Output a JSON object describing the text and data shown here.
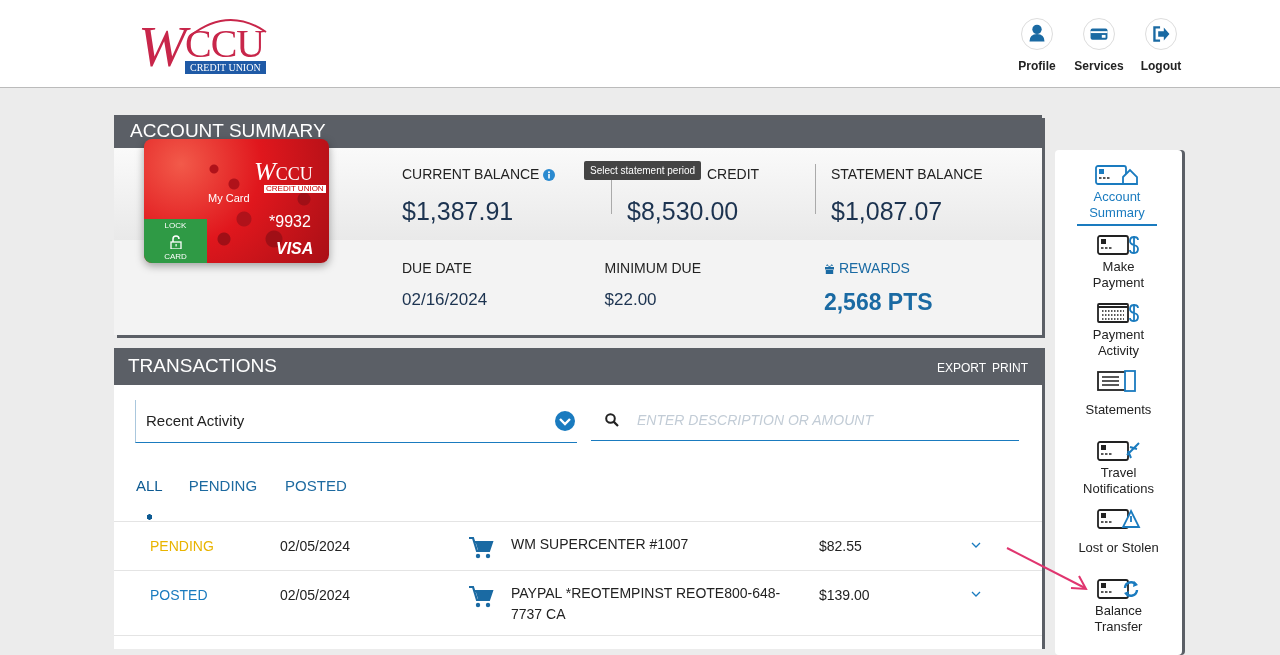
{
  "header": {
    "logo": {
      "letter": "W",
      "wordmark": "CCU",
      "tagline": "CREDIT UNION"
    },
    "actions": [
      {
        "label": "Profile",
        "kind": "profile"
      },
      {
        "label": "Services",
        "kind": "services"
      },
      {
        "label": "Logout",
        "kind": "logout"
      }
    ]
  },
  "account_summary": {
    "title": "ACCOUNT SUMMARY",
    "card": {
      "logo_letter": "W",
      "logo_wordmark": "CCU",
      "logo_tagline": "CREDIT UNION",
      "name": "My Card",
      "number": "*9932",
      "network": "VISA",
      "lock_top": "LOCK",
      "lock_bottom": "CARD"
    },
    "stats": [
      {
        "label": "CURRENT BALANCE",
        "value": "$1,387.91",
        "kind": "info"
      },
      {
        "label": "CREDIT",
        "value": "$8,530.00",
        "kind": "plain"
      },
      {
        "label": "STATEMENT BALANCE",
        "value": "$1,087.07",
        "kind": "plain"
      },
      {
        "label": "DUE DATE",
        "value": "02/16/2024",
        "kind": "plain"
      },
      {
        "label": "MINIMUM DUE",
        "value": "$22.00",
        "kind": "plain"
      },
      {
        "label": "REWARDS",
        "value": "2,568 PTS",
        "kind": "rewards"
      }
    ],
    "tooltip": "Select statement period"
  },
  "transactions": {
    "title": "TRANSACTIONS",
    "actions": [
      "EXPORT",
      "PRINT"
    ],
    "filter": {
      "value": "Recent Activity"
    },
    "search": {
      "placeholder": "ENTER DESCRIPTION OR AMOUNT"
    },
    "tabs": [
      {
        "label": "ALL",
        "selected": true
      },
      {
        "label": "PENDING",
        "selected": false
      },
      {
        "label": "POSTED",
        "selected": false
      }
    ],
    "rows": [
      {
        "status": "PENDING",
        "kind": "pending",
        "date": "02/05/2024",
        "description": "WM SUPERCENTER #1007",
        "amount": "$82.55"
      },
      {
        "status": "POSTED",
        "kind": "posted",
        "date": "02/05/2024",
        "description": "PAYPAL *REOTEMPINST REOTE800-648-7737 CA",
        "amount": "$139.00"
      }
    ]
  },
  "side_nav": {
    "items": [
      {
        "label": "Account Summary",
        "kind": "home",
        "selected": true
      },
      {
        "label": "Make Payment",
        "kind": "dollar",
        "selected": false
      },
      {
        "label": "Payment Activity",
        "kind": "calendar",
        "selected": false
      },
      {
        "label": "Statements",
        "kind": "statements",
        "selected": false
      },
      {
        "label": "Travel Notifications",
        "kind": "plane",
        "selected": false
      },
      {
        "label": "Lost or Stolen",
        "kind": "warning",
        "selected": false
      },
      {
        "label": "Balance Transfer",
        "kind": "transfer",
        "selected": false
      }
    ]
  }
}
